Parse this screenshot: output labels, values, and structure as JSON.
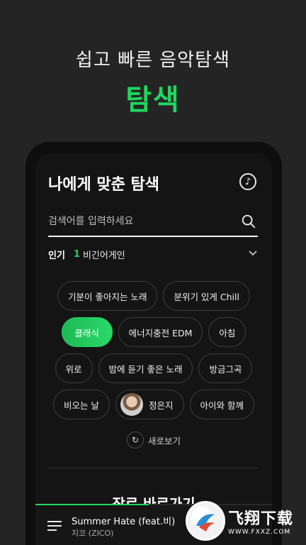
{
  "promo": {
    "subtitle": "쉽고 빠른 음악탐색",
    "title": "탐색",
    "title_color": "#1ed760"
  },
  "header": {
    "title": "나에게 맞춘 탐색",
    "music_icon": "music-note-circle-icon"
  },
  "search": {
    "placeholder": "검색어를 입력하세요",
    "value": "",
    "icon": "search-icon"
  },
  "popular": {
    "label": "인기",
    "rank": "1",
    "term": "비긴어게인",
    "expand_icon": "chevron-down-icon"
  },
  "chips": {
    "rows": [
      [
        {
          "label": "기분이 좋아지는 노래"
        },
        {
          "label": "분위기 있게 Chill"
        }
      ],
      [
        {
          "label": "클래식",
          "active": true
        },
        {
          "label": "에너지충전 EDM"
        },
        {
          "label": "아침"
        }
      ],
      [
        {
          "label": "위로"
        },
        {
          "label": "밤에 듣기 좋은 노래"
        },
        {
          "label": "방금그곡"
        }
      ],
      [
        {
          "label": "비오는 날"
        },
        {
          "label": "정은지",
          "avatar": true
        },
        {
          "label": "아이와 함께"
        }
      ]
    ]
  },
  "refresh": {
    "label": "새로보기",
    "icon": "refresh-icon"
  },
  "genre": {
    "title": "장르 바로가기"
  },
  "player": {
    "track_title": "Summer Hate (feat.비)",
    "artist": "지코 (ZICO)",
    "progress": 0.48,
    "queue_icon": "playlist-icon"
  },
  "watermark": {
    "brand": "飞翔下载",
    "url": "WWW.FXXZ.COM"
  },
  "colors": {
    "accent": "#1ed760",
    "background": "#242424",
    "screen": "#141414"
  }
}
